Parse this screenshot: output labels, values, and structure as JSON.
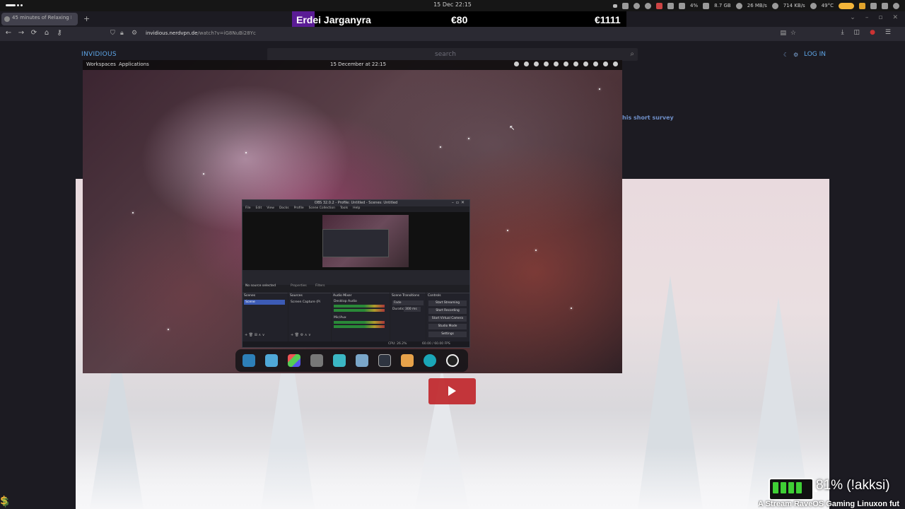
{
  "system_bar": {
    "clock": "15 Dec  22:15",
    "cpu": "4%",
    "ram": "8.7 GB",
    "download": "26 MB/s",
    "upload": "714 KB/s",
    "temperature": "49°C"
  },
  "overlay_banner": {
    "name": "Erdei Jarganyra",
    "value_1": "€80",
    "value_2": "€1111",
    "accent": "#5a1c95"
  },
  "browser": {
    "tab_title": "45 minutes of Relaxing F",
    "new_tab": "+",
    "url_domain": "invidious.nerdvpn.de",
    "url_path": "/watch?v=iG8NuBi28Yc",
    "nav_back": "←",
    "nav_forward": "→",
    "nav_reload": "⟳",
    "nav_home": "⌂"
  },
  "page": {
    "logo": "INVIDIOUS",
    "search_placeholder": "search",
    "login": "LOG IN",
    "survey_link": "his short survey"
  },
  "desktop": {
    "workspaces": "Workspaces",
    "applications": "Applications",
    "datetime": "15 December at 22:15"
  },
  "obs": {
    "title": "OBS 32.0.2 - Profile: Untitled - Scenes: Untitled",
    "menu": [
      "File",
      "Edit",
      "View",
      "Docks",
      "Profile",
      "Scene Collection",
      "Tools",
      "Help"
    ],
    "no_source": "No source selected",
    "properties": "Properties",
    "filters": "Filters",
    "docks": {
      "scenes": "Scenes",
      "sources": "Sources",
      "audio_mixer": "Audio Mixer",
      "scene_transitions": "Scene Transitions",
      "controls": "Controls"
    },
    "scene_item": "Scene",
    "source_item": "Screen Capture (Pi",
    "audio_desktop": "Desktop Audio",
    "audio_mic": "Mic/Aux",
    "transition": "Fade",
    "duration_label": "Duration",
    "duration_value": "300 ms",
    "controls": [
      "Start Streaming",
      "Start Recording",
      "Start Virtual Camera",
      "Studio Mode",
      "Settings"
    ],
    "status_cpu": "CPU: 26.2%",
    "status_fps": "60.00 / 60.00 FPS"
  },
  "bottom_overlay": {
    "battery_text": "81% (!akksi)",
    "battery_level": 0.81,
    "ticker": "A Stream RaveOS Gaming Linuxon fut"
  }
}
